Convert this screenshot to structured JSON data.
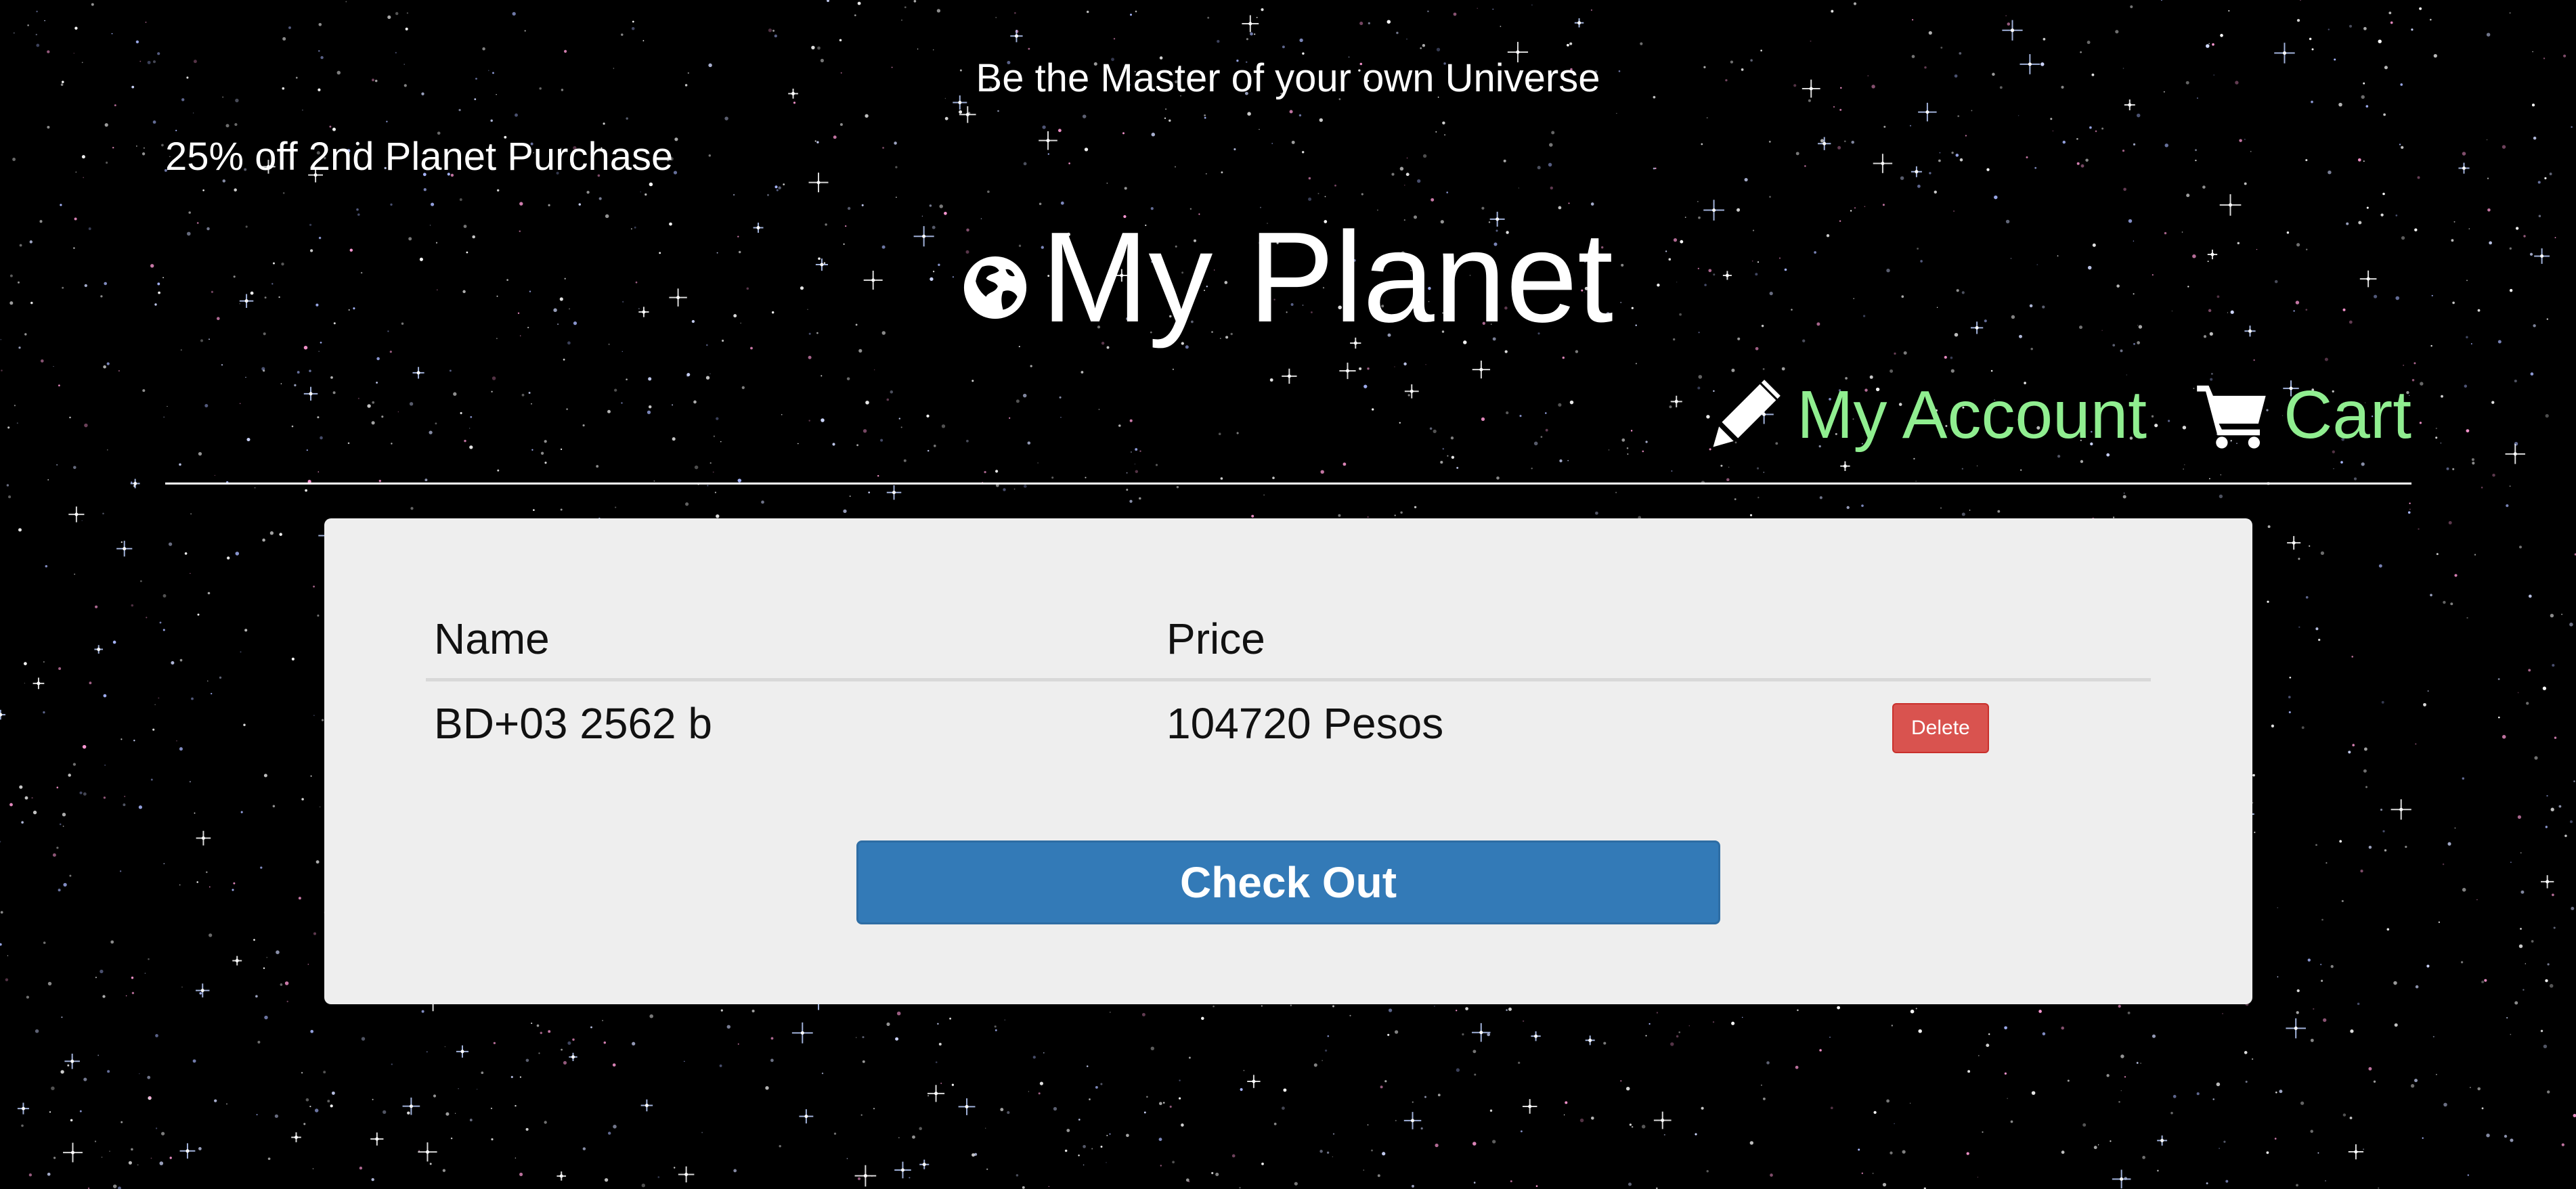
{
  "header": {
    "tagline": "Be the Master of your own Universe",
    "promo": "25% off 2nd Planet Purchase",
    "title": "My Planet",
    "logo_icon": "globe-icon"
  },
  "nav": {
    "account_label": "My Account",
    "account_icon": "pencil-icon",
    "cart_label": "Cart",
    "cart_icon": "shopping-cart-icon",
    "link_color": "#90ee90"
  },
  "cart": {
    "columns": [
      "Name",
      "Price"
    ],
    "rows": [
      {
        "name": "BD+03 2562 b",
        "price": "104720 Pesos",
        "action_label": "Delete"
      }
    ],
    "checkout_label": "Check Out"
  },
  "colors": {
    "background": "#000000",
    "panel": "#eeeeee",
    "checkout_button": "#337ab7",
    "delete_button": "#d9534f"
  }
}
